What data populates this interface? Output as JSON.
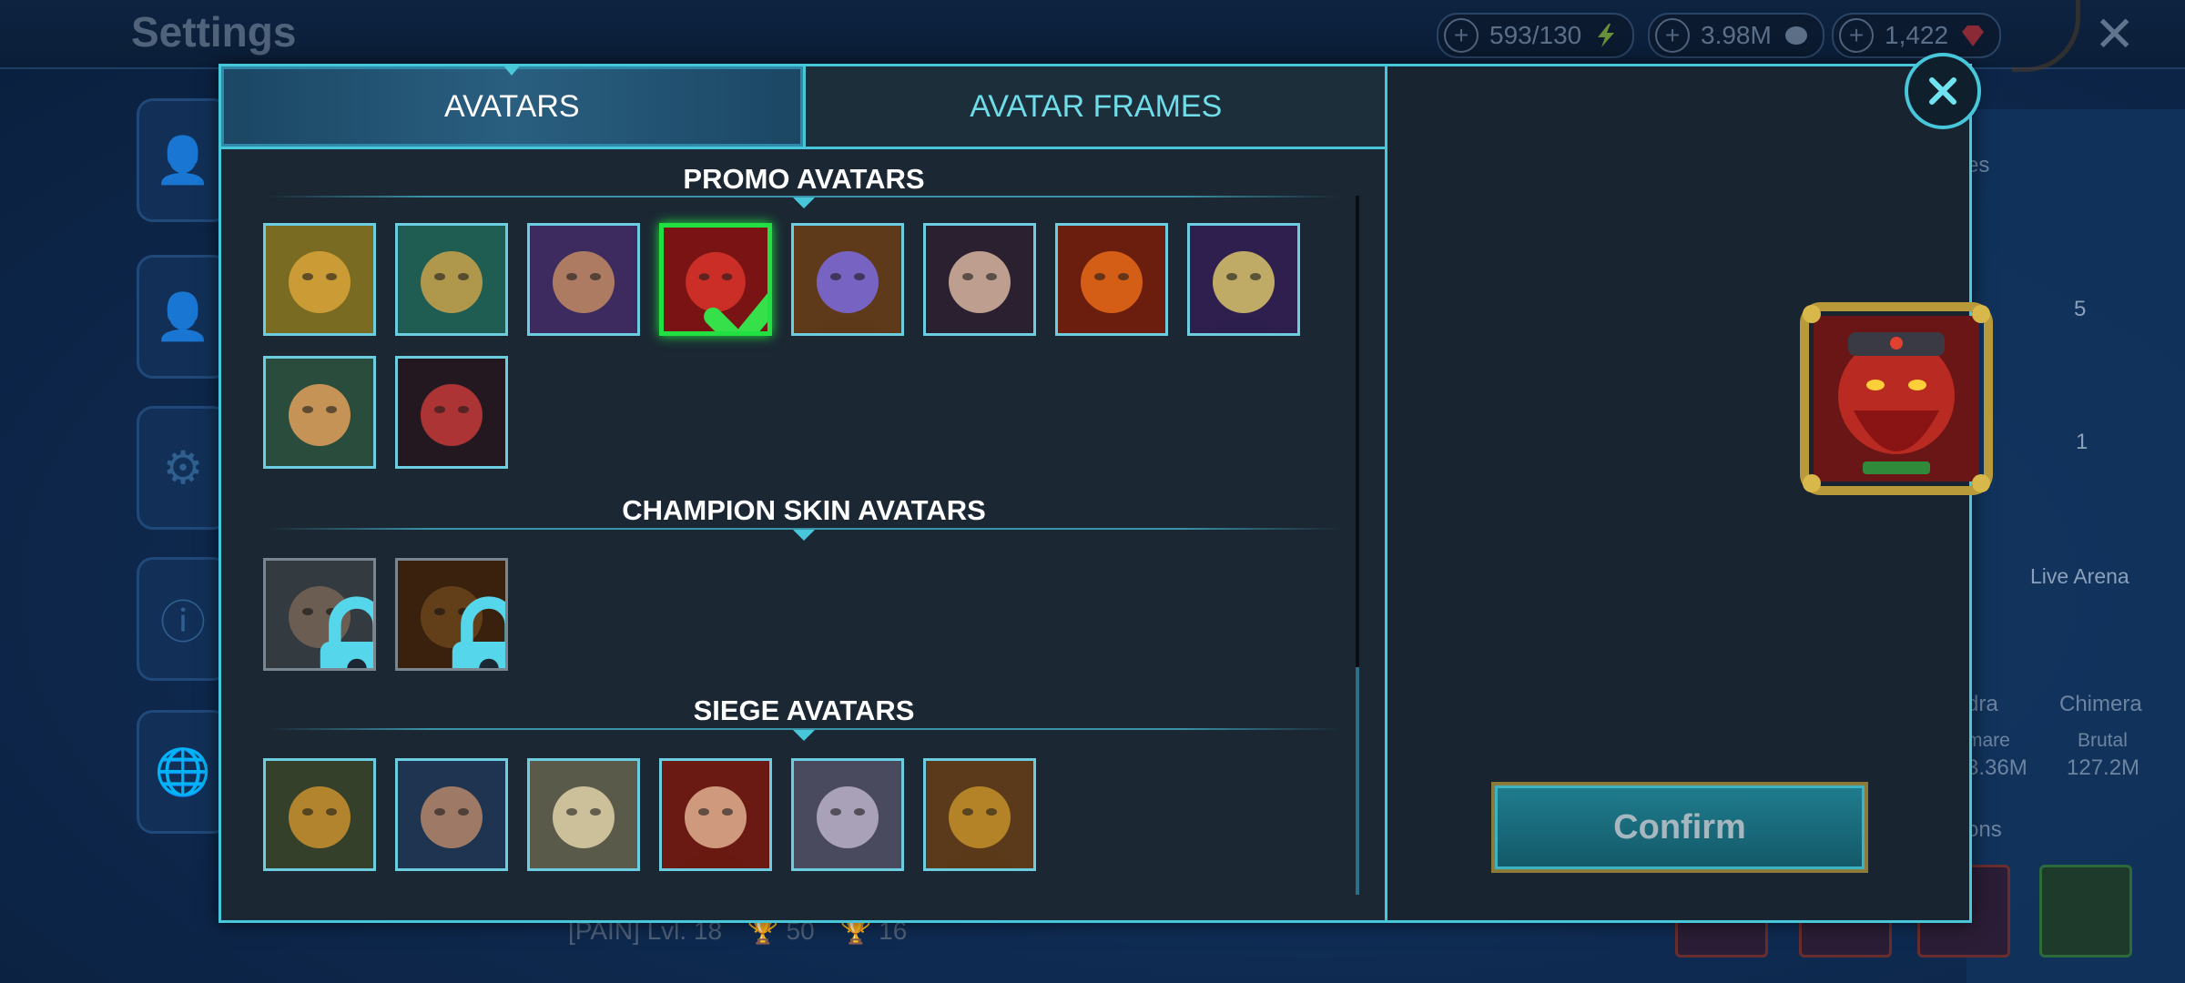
{
  "background": {
    "title": "Settings",
    "resources": [
      {
        "value": "593/130",
        "icon": "energy-icon",
        "color": "#7fbf3a"
      },
      {
        "value": "3.98M",
        "icon": "silver-icon",
        "color": "#8aa0bf"
      },
      {
        "value": "1,422",
        "icon": "gem-icon",
        "color": "#d63a4a"
      }
    ],
    "player_info": "[PAIN] Lvl. 18",
    "stat_1": "50",
    "stat_2": "16",
    "right_labels": {
      "live_arena": "Live Arena",
      "hydra": "dra",
      "chimera": "Chimera",
      "nightmare": "mare",
      "brutal": "Brutal",
      "hydra_value": "3.36M",
      "chimera_value": "127.2M",
      "ons": "ons",
      "es": "es",
      "rank_badge": "5",
      "rank_badge_2": "1"
    }
  },
  "tabs": [
    {
      "label": "AVATARS",
      "active": true
    },
    {
      "label": "AVATAR FRAMES",
      "active": false
    }
  ],
  "sections": {
    "promo": {
      "title": "PROMO AVATARS",
      "avatars": [
        {
          "name": "toad-champion",
          "color": "#7a6b22",
          "accent": "#d9a53a"
        },
        {
          "name": "gold-helm-champion",
          "color": "#1f5c52",
          "accent": "#c9a24a"
        },
        {
          "name": "purple-hood-champion",
          "color": "#3d2a5e",
          "accent": "#c08a62"
        },
        {
          "name": "red-dwarf-champion",
          "color": "#7a1414",
          "accent": "#d8322a",
          "selected": true
        },
        {
          "name": "visor-champion",
          "color": "#5e3a1a",
          "accent": "#7b6be0"
        },
        {
          "name": "dark-hair-champion",
          "color": "#2a2030",
          "accent": "#d8b5a0"
        },
        {
          "name": "fire-beast-champion",
          "color": "#6b1e0d",
          "accent": "#e86a1a"
        },
        {
          "name": "skull-champion",
          "color": "#2e1f4e",
          "accent": "#d8c46a"
        },
        {
          "name": "elf-champion",
          "color": "#2a4c3c",
          "accent": "#e2a05a"
        },
        {
          "name": "red-cape-champion",
          "color": "#241820",
          "accent": "#c43a3a"
        }
      ]
    },
    "skins": {
      "title": "CHAMPION SKIN AVATARS",
      "avatars": [
        {
          "name": "skin-female-champion",
          "color": "#4f5a63",
          "accent": "#b59a82",
          "locked": true
        },
        {
          "name": "skin-beast-champion",
          "color": "#5a3414",
          "accent": "#a26a2a",
          "locked": true
        }
      ]
    },
    "siege": {
      "title": "SIEGE AVATARS",
      "avatars": [
        {
          "name": "orc-champion",
          "color": "#34402a",
          "accent": "#c9902e"
        },
        {
          "name": "warrior-champion",
          "color": "#1f3450",
          "accent": "#b5866a"
        },
        {
          "name": "lion-champion",
          "color": "#5a5a4a",
          "accent": "#e0d2a8"
        },
        {
          "name": "queen-champion",
          "color": "#6a1a12",
          "accent": "#e0b090"
        },
        {
          "name": "pale-elf-champion",
          "color": "#4a4a5e",
          "accent": "#b8b0c8"
        },
        {
          "name": "ape-champion",
          "color": "#5a3a1a",
          "accent": "#c4902a"
        }
      ]
    }
  },
  "preview": {
    "name": "red-dwarf-champion",
    "color": "#8a1616",
    "accent": "#e0402e",
    "frame": "#b89a3a"
  },
  "confirm_label": "Confirm"
}
